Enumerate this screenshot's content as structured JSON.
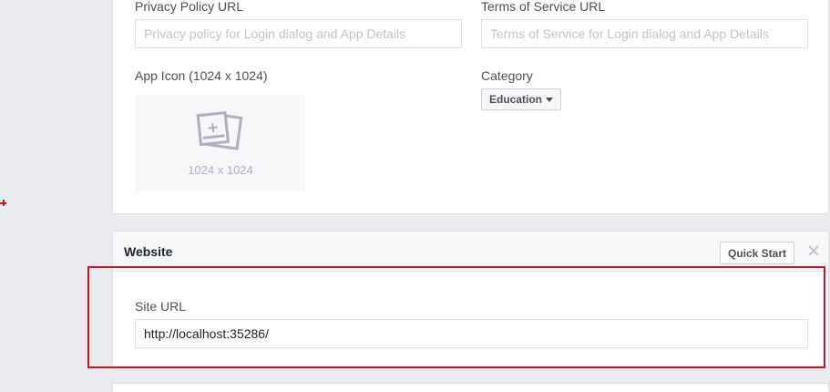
{
  "basic": {
    "privacy_label": "Privacy Policy URL",
    "privacy_placeholder": "Privacy policy for Login dialog and App Details",
    "terms_label": "Terms of Service URL",
    "terms_placeholder": "Terms of Service for Login dialog and App Details",
    "app_icon_label": "App Icon (1024 x 1024)",
    "app_icon_size_text": "1024 x 1024",
    "category_label": "Category",
    "category_value": "Education"
  },
  "website": {
    "title": "Website",
    "quick_start_label": "Quick Start",
    "site_url_label": "Site URL",
    "site_url_value": "http://localhost:35286/"
  },
  "icons": {
    "app_icon_placeholder": "image-placeholder-icon",
    "close": "close-icon",
    "category_dropdown": "caret-down-icon"
  },
  "colors": {
    "highlight": "#c4161c",
    "page_background": "#e9ebee",
    "card_background": "#ffffff"
  }
}
